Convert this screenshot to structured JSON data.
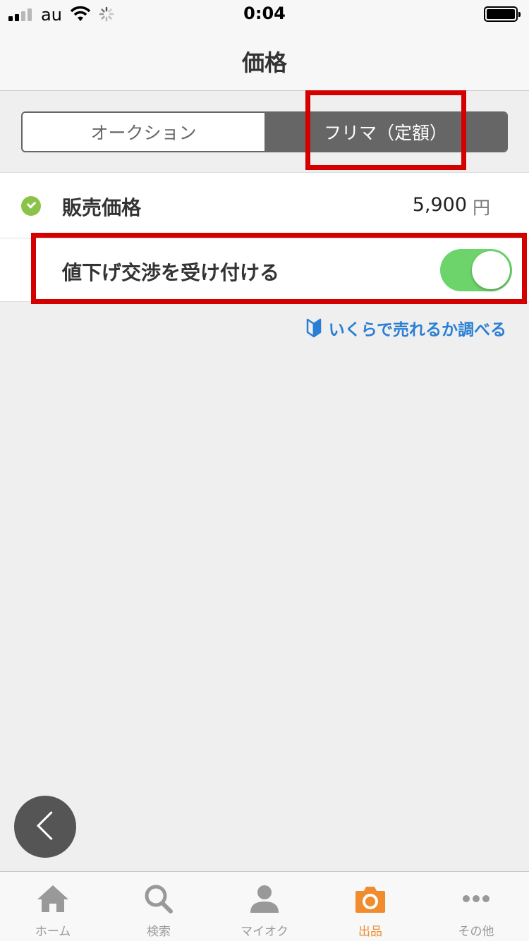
{
  "status_bar": {
    "carrier": "au",
    "time": "0:04"
  },
  "nav": {
    "title": "価格"
  },
  "segments": {
    "auction": "オークション",
    "fixed": "フリマ（定額）",
    "selected": "fixed"
  },
  "price": {
    "label": "販売価格",
    "value": "5,900",
    "unit": "円"
  },
  "negotiation": {
    "label": "値下げ交渉を受け付ける",
    "enabled": true
  },
  "link": {
    "label": "いくらで売れるか調べる"
  },
  "tabs": [
    {
      "label": "ホーム",
      "icon": "home-icon",
      "active": false
    },
    {
      "label": "検索",
      "icon": "search-icon",
      "active": false
    },
    {
      "label": "マイオク",
      "icon": "person-icon",
      "active": false
    },
    {
      "label": "出品",
      "icon": "camera-icon",
      "active": true
    },
    {
      "label": "その他",
      "icon": "more-icon",
      "active": false
    }
  ],
  "colors": {
    "accent_orange": "#f08c2e",
    "toggle_on": "#6dd36b",
    "link_blue": "#2a7fd4",
    "highlight_red": "#d40000",
    "check_green": "#8bc34a"
  }
}
